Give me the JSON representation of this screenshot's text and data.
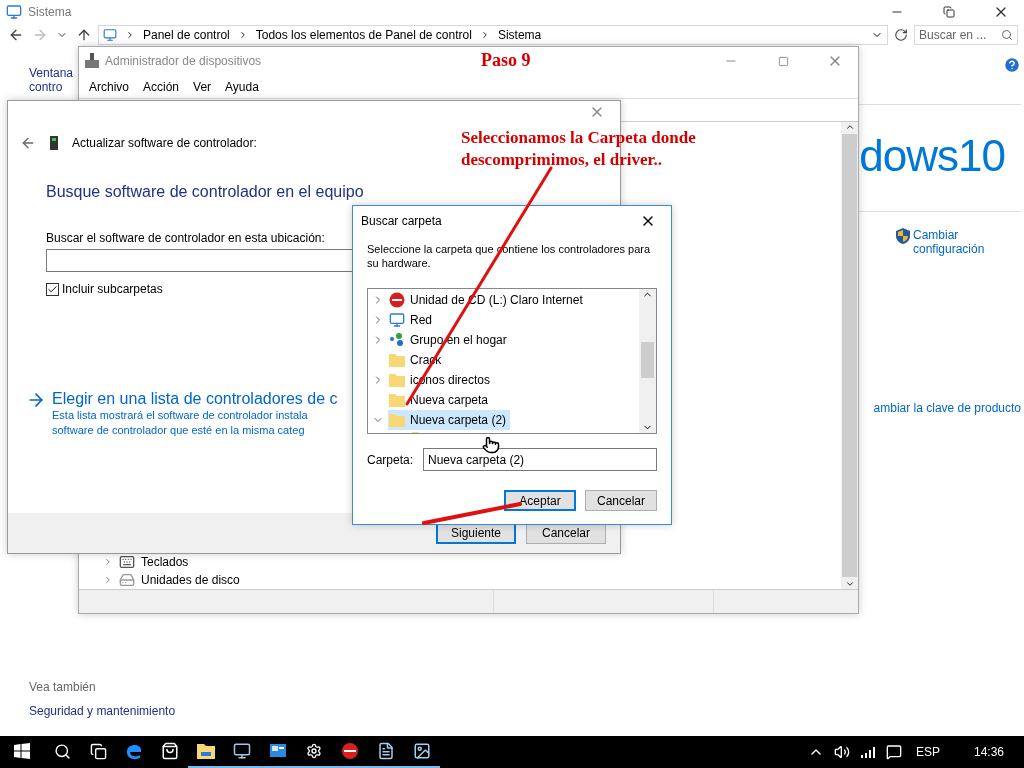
{
  "system_window": {
    "title": "Sistema",
    "breadcrumb": [
      "Panel de control",
      "Todos los elementos de Panel de control",
      "Sistema"
    ],
    "search": {
      "placeholder": "Buscar en ..."
    },
    "left_links": [
      "Ventana",
      "contro"
    ],
    "logo_text": "dows10",
    "change_settings": "Cambiar configuración",
    "product_key_link": "ambiar la clave de producto",
    "see_also": {
      "title": "Vea también",
      "links": [
        "Seguridad y mantenimiento"
      ]
    }
  },
  "device_manager": {
    "title": "Administrador de dispositivos",
    "menu": [
      "Archivo",
      "Acción",
      "Ver",
      "Ayuda"
    ],
    "tree": [
      {
        "label": "Teclados",
        "expanded": false
      },
      {
        "label": "Unidades de disco",
        "expanded": false
      }
    ]
  },
  "wizard": {
    "header": "Actualizar software de controlador:",
    "heading": "Busque software de controlador en el equipo",
    "location_label": "Buscar el software de controlador en esta ubicación:",
    "include_subfolders": {
      "label": "Incluir subcarpetas",
      "checked": true
    },
    "link": {
      "title": "Elegir en una lista de controladores de c",
      "description": [
        "Esta lista mostrará el software de controlador instala",
        "software de controlador que esté en la misma categ"
      ]
    },
    "buttons": [
      {
        "label": "Siguiente",
        "default": true
      },
      {
        "label": "Cancelar",
        "default": false
      }
    ]
  },
  "folder_dialog": {
    "title": "Buscar carpeta",
    "description": "Seleccione la carpeta que contiene los controladores para su hardware.",
    "tree": [
      {
        "label": "Unidad de CD (L:) Claro Internet",
        "kind": "cd",
        "expandable": true,
        "expanded": false,
        "selected": false
      },
      {
        "label": "Red",
        "kind": "network",
        "expandable": true,
        "expanded": false,
        "selected": false
      },
      {
        "label": "Grupo en el hogar",
        "kind": "homegroup",
        "expandable": true,
        "expanded": false,
        "selected": false
      },
      {
        "label": "Crack",
        "kind": "folder",
        "expandable": false,
        "selected": false
      },
      {
        "label": "iconos directos",
        "kind": "folder",
        "expandable": true,
        "expanded": false,
        "selected": false
      },
      {
        "label": "Nueva carpeta",
        "kind": "folder",
        "expandable": false,
        "selected": false
      },
      {
        "label": "Nueva carpeta (2)",
        "kind": "folder",
        "expandable": true,
        "expanded": true,
        "selected": true
      }
    ],
    "folder_label": "Carpeta:",
    "folder_value": "Nueva carpeta (2)",
    "buttons": [
      {
        "label": "Aceptar",
        "default": true
      },
      {
        "label": "Cancelar",
        "default": false
      }
    ]
  },
  "annotations": {
    "step": "Paso 9",
    "note": "Seleccionamos la Carpeta donde descomprimimos, el driver.."
  },
  "taskbar": {
    "apps": [
      {
        "kind": "edge",
        "running": false
      },
      {
        "kind": "store",
        "running": false
      },
      {
        "kind": "explorer",
        "running": true
      },
      {
        "kind": "monitor",
        "running": true
      },
      {
        "kind": "panel",
        "running": true
      },
      {
        "kind": "settings",
        "running": true
      },
      {
        "kind": "disc",
        "running": true
      },
      {
        "kind": "notepad",
        "running": true
      },
      {
        "kind": "picture",
        "running": true
      }
    ],
    "language": "ESP",
    "clock": "14:36"
  }
}
